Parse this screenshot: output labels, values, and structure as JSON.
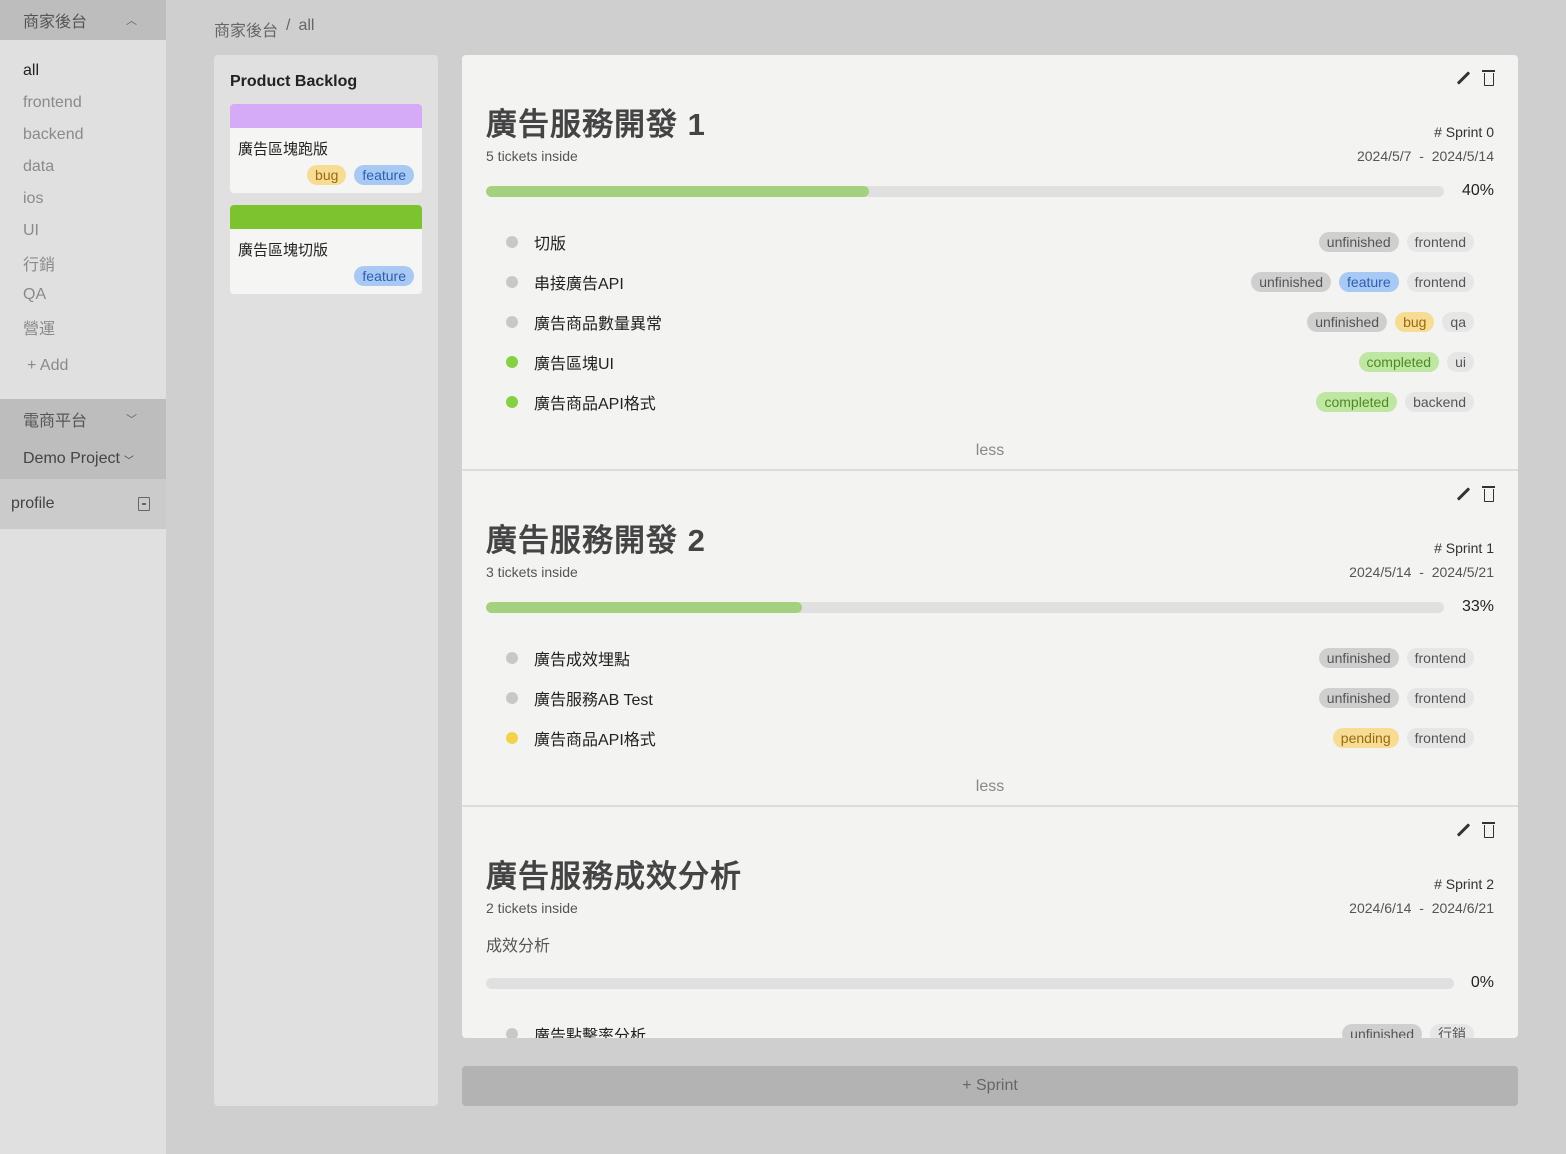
{
  "sidebar": {
    "group_title": "商家後台",
    "items": [
      "all",
      "frontend",
      "backend",
      "data",
      "ios",
      "UI",
      "行銷",
      "QA",
      "營運"
    ],
    "add_label": "+ Add",
    "project1": "電商平台",
    "project2": "Demo Project",
    "profile": "profile"
  },
  "breadcrumb": {
    "root": "商家後台",
    "sep": "/",
    "current": "all"
  },
  "backlog": {
    "title": "Product Backlog",
    "cards": [
      {
        "color": "#d5aaf6",
        "title": "廣告區塊跑版",
        "tags": [
          {
            "label": "bug",
            "style": "yellow"
          },
          {
            "label": "feature",
            "style": "blue"
          }
        ]
      },
      {
        "color": "#7dc22f",
        "title": "廣告區塊切版",
        "tags": [
          {
            "label": "feature",
            "style": "blue"
          }
        ]
      }
    ]
  },
  "sprints": [
    {
      "title": "廣告服務開發 1",
      "sprint_no": "# Sprint 0",
      "tickets_count": "5 tickets inside",
      "start": "2024/5/7",
      "end": "2024/5/14",
      "desc": "",
      "progress": 0.4,
      "percent": "40%",
      "tickets": [
        {
          "status": "grey",
          "name": "切版",
          "tags": [
            {
              "label": "unfinished",
              "style": "gray"
            },
            {
              "label": "frontend",
              "style": "light"
            }
          ]
        },
        {
          "status": "grey",
          "name": "串接廣告API",
          "tags": [
            {
              "label": "unfinished",
              "style": "gray"
            },
            {
              "label": "feature",
              "style": "blue"
            },
            {
              "label": "frontend",
              "style": "light"
            }
          ]
        },
        {
          "status": "grey",
          "name": "廣告商品數量異常",
          "tags": [
            {
              "label": "unfinished",
              "style": "gray"
            },
            {
              "label": "bug",
              "style": "yellow"
            },
            {
              "label": "qa",
              "style": "light"
            }
          ]
        },
        {
          "status": "green",
          "name": "廣告區塊UI",
          "tags": [
            {
              "label": "completed",
              "style": "green"
            },
            {
              "label": "ui",
              "style": "light"
            }
          ]
        },
        {
          "status": "green",
          "name": "廣告商品API格式",
          "tags": [
            {
              "label": "completed",
              "style": "green"
            },
            {
              "label": "backend",
              "style": "light"
            }
          ]
        }
      ],
      "less": "less"
    },
    {
      "title": "廣告服務開發 2",
      "sprint_no": "# Sprint 1",
      "tickets_count": "3 tickets inside",
      "start": "2024/5/14",
      "end": "2024/5/21",
      "desc": "",
      "progress": 0.33,
      "percent": "33%",
      "tickets": [
        {
          "status": "grey",
          "name": "廣告成效埋點",
          "tags": [
            {
              "label": "unfinished",
              "style": "gray"
            },
            {
              "label": "frontend",
              "style": "light"
            }
          ]
        },
        {
          "status": "grey",
          "name": "廣告服務AB Test",
          "tags": [
            {
              "label": "unfinished",
              "style": "gray"
            },
            {
              "label": "frontend",
              "style": "light"
            }
          ]
        },
        {
          "status": "yellow",
          "name": "廣告商品API格式",
          "tags": [
            {
              "label": "pending",
              "style": "yellow"
            },
            {
              "label": "frontend",
              "style": "light"
            }
          ]
        }
      ],
      "less": "less"
    },
    {
      "title": "廣告服務成效分析",
      "sprint_no": "# Sprint 2",
      "tickets_count": "2 tickets inside",
      "start": "2024/6/14",
      "end": "2024/6/21",
      "desc": "成效分析",
      "progress": 0,
      "percent": "0%",
      "tickets": [
        {
          "status": "grey",
          "name": "廣告點擊率分析",
          "tags": [
            {
              "label": "unfinished",
              "style": "gray"
            },
            {
              "label": "行銷",
              "style": "light"
            }
          ]
        }
      ],
      "less": ""
    }
  ],
  "add_sprint_label": "+ Sprint",
  "colors": {
    "progress_fill": "#a3d17f",
    "sidebar_bg": "#e0e0e0",
    "panel_bg": "#f3f3f1"
  }
}
